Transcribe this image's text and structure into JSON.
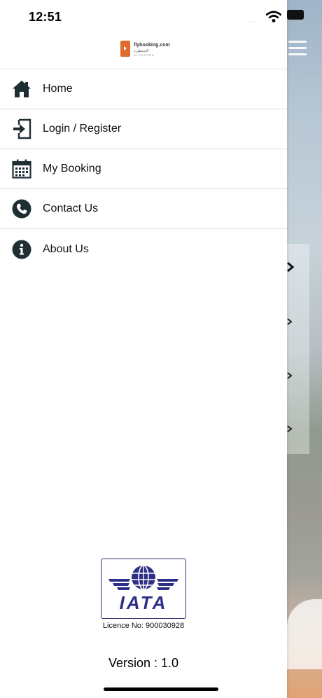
{
  "status_bar": {
    "time": "12:51",
    "signal": "....",
    "wifi_icon": "wifi-icon"
  },
  "logo": {
    "line1": "flybooking.com",
    "line2": "الاستطورة",
    "line3": "ALOSTORA",
    "accent": "#e06b2c"
  },
  "menu": {
    "items": [
      {
        "label": "Home",
        "icon": "home-icon"
      },
      {
        "label": "Login / Register",
        "icon": "login-icon"
      },
      {
        "label": "My Booking",
        "icon": "calendar-icon"
      },
      {
        "label": "Contact Us",
        "icon": "phone-icon"
      },
      {
        "label": "About Us",
        "icon": "info-icon"
      }
    ],
    "icon_color": "#1f2e33"
  },
  "iata": {
    "logo_text": "IATA",
    "licence": "Licence No: 900030928",
    "brand_color": "#2d2f86"
  },
  "footer": {
    "version": "Version : 1.0"
  }
}
